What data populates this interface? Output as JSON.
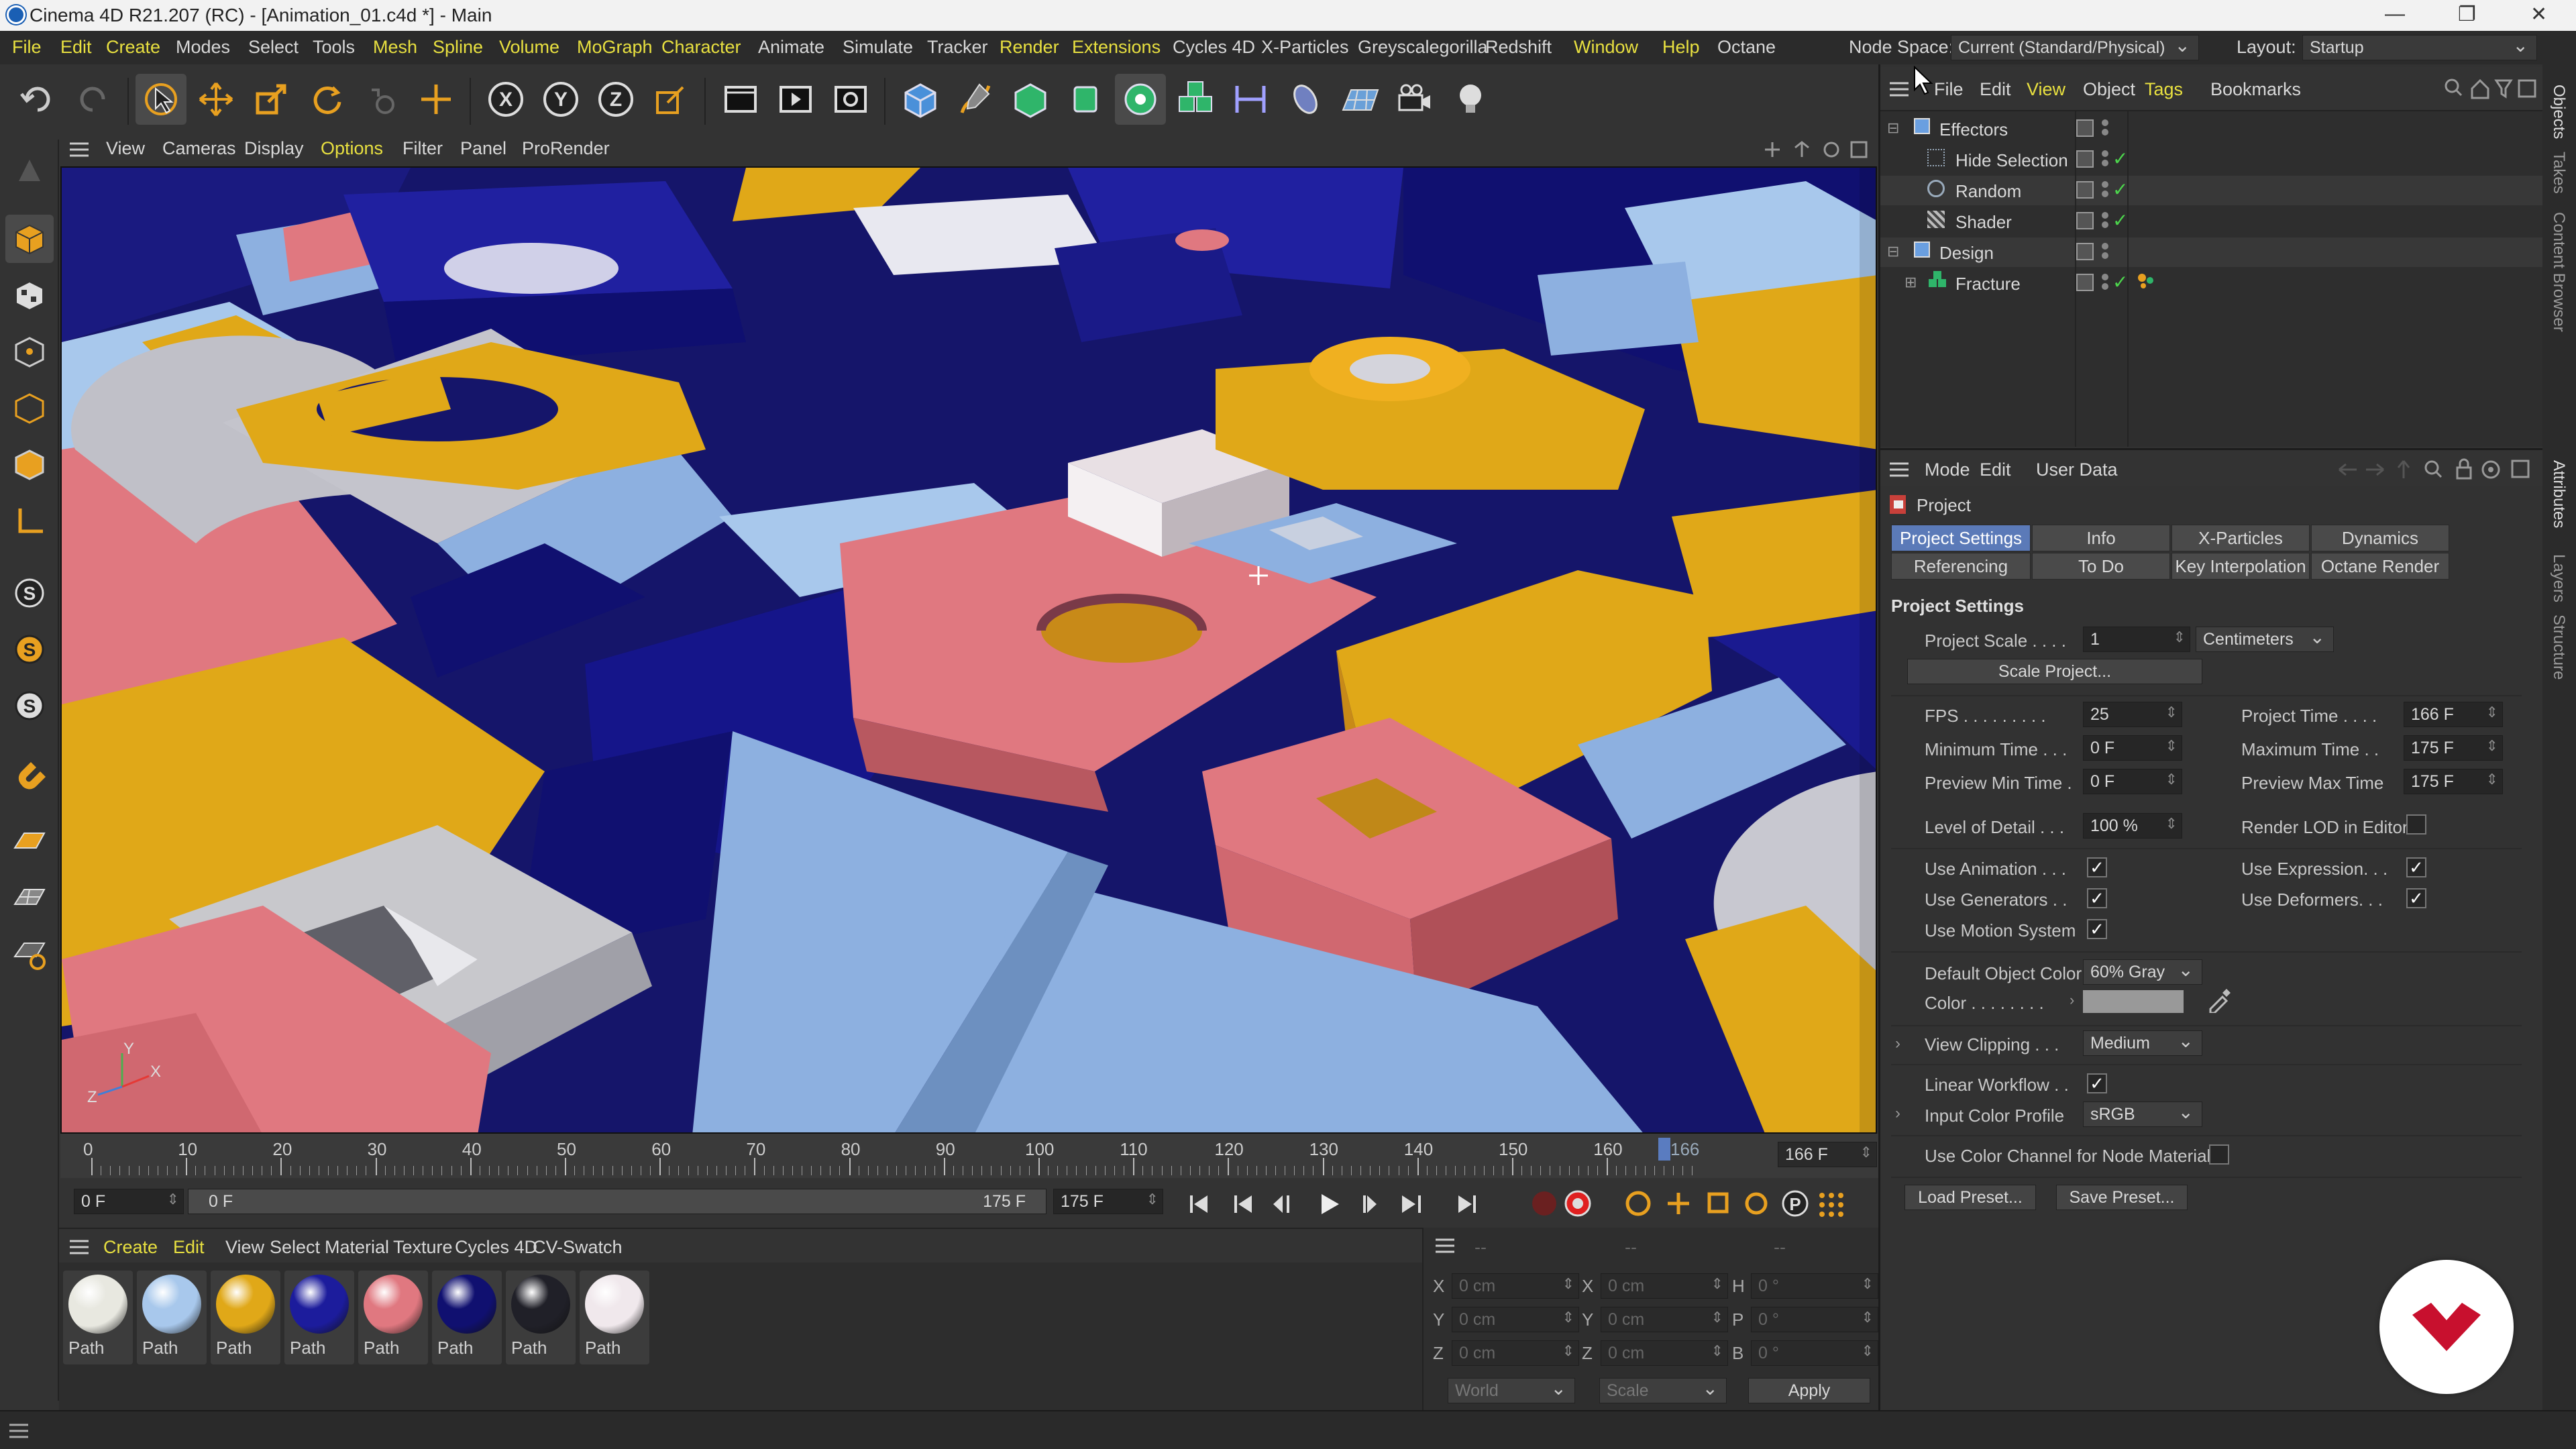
{
  "window": {
    "title": "Cinema 4D R21.207 (RC) - [Animation_01.c4d *] - Main",
    "minimize": "—",
    "restore": "❐",
    "close": "✕"
  },
  "menu": {
    "items": [
      "File",
      "Edit",
      "Create",
      "Modes",
      "Select",
      "Tools",
      "Mesh",
      "Spline",
      "Volume",
      "MoGraph",
      "Character",
      "Animate",
      "Simulate",
      "Tracker",
      "Render",
      "Extensions",
      "Cycles 4D",
      "X-Particles",
      "Greyscalegorilla",
      "Redshift",
      "Window",
      "Help",
      "Octane"
    ],
    "node_space_label": "Node Space:",
    "node_space_value": "Current (Standard/Physical)",
    "layout_label": "Layout:",
    "layout_value": "Startup"
  },
  "viewport_menu": {
    "items": [
      "View",
      "Cameras",
      "Display",
      "Options",
      "Filter",
      "Panel",
      "ProRender"
    ]
  },
  "object_manager": {
    "menu": [
      "File",
      "Edit",
      "View",
      "Object",
      "Tags",
      "Bookmarks"
    ],
    "objects": [
      {
        "name": "Effectors",
        "level": 0
      },
      {
        "name": "Hide Selection",
        "level": 1
      },
      {
        "name": "Random",
        "level": 1
      },
      {
        "name": "Shader",
        "level": 1
      },
      {
        "name": "Design",
        "level": 0
      },
      {
        "name": "Fracture",
        "level": 1
      }
    ]
  },
  "attributes": {
    "menu": [
      "Mode",
      "Edit",
      "User Data"
    ],
    "object_name": "Project",
    "tabs_row1": [
      "Project Settings",
      "Info",
      "X-Particles",
      "Dynamics"
    ],
    "tabs_row2": [
      "Referencing",
      "To Do",
      "Key Interpolation",
      "Octane Render"
    ],
    "section_title": "Project Settings",
    "project_scale_label": "Project Scale . . . .",
    "project_scale_value": "1",
    "project_scale_unit": "Centimeters",
    "scale_project_button": "Scale Project...",
    "fps_label": "FPS . . . . . . . . .",
    "fps_value": "25",
    "project_time_label": "Project Time . . . .",
    "project_time_value": "166 F",
    "min_time_label": "Minimum Time . . .",
    "min_time_value": "0 F",
    "max_time_label": "Maximum Time . .",
    "max_time_value": "175 F",
    "prev_min_label": "Preview Min Time .",
    "prev_min_value": "0 F",
    "prev_max_label": "Preview Max Time",
    "prev_max_value": "175 F",
    "lod_label": "Level of Detail . . .",
    "lod_value": "100 %",
    "render_lod_label": "Render LOD in Editor",
    "use_animation_label": "Use Animation . . .",
    "use_expression_label": "Use Expression. . .",
    "use_generators_label": "Use Generators . .",
    "use_deformers_label": "Use Deformers. . .",
    "use_motion_label": "Use Motion System",
    "default_color_label": "Default Object Color",
    "default_color_value": "60% Gray",
    "color_label": "Color . . . . . . . .",
    "view_clipping_label": "View Clipping . . .",
    "view_clipping_value": "Medium",
    "linear_workflow_label": "Linear Workflow . .",
    "input_profile_label": "Input Color Profile",
    "input_profile_value": "sRGB",
    "color_channel_label": "Use Color Channel for Node Material",
    "load_preset": "Load Preset...",
    "save_preset": "Save Preset..."
  },
  "side_tabs": [
    "Objects",
    "Takes",
    "Content Browser",
    "Attributes",
    "Layers",
    "Structure"
  ],
  "timeline": {
    "ticks": [
      "0",
      "10",
      "20",
      "30",
      "40",
      "50",
      "60",
      "70",
      "80",
      "90",
      "100",
      "110",
      "120",
      "130",
      "140",
      "150",
      "160"
    ],
    "current_marker": "166",
    "end_field": "166 F",
    "start_field": "0 F",
    "range_start": "0 F",
    "range_end": "175 F",
    "end_frame": "175 F"
  },
  "materials": {
    "menu": [
      "Create",
      "Edit",
      "View",
      "Select",
      "Material",
      "Texture",
      "Cycles 4D",
      "CV-Swatch"
    ],
    "items": [
      {
        "label": "Path",
        "color": "#e8e8e0"
      },
      {
        "label": "Path",
        "color": "#a8c8ec"
      },
      {
        "label": "Path",
        "color": "#e0a818"
      },
      {
        "label": "Path",
        "color": "#1c1c9c"
      },
      {
        "label": "Path",
        "color": "#e07880"
      },
      {
        "label": "Path",
        "color": "#101070"
      },
      {
        "label": "Path",
        "color": "#202028"
      },
      {
        "label": "Path",
        "color": "#f0e8ec"
      }
    ]
  },
  "coordinates": {
    "header_dashes": [
      "--",
      "--",
      "--"
    ],
    "rows": [
      {
        "a": "X",
        "av": "0 cm",
        "b": "X",
        "bv": "0 cm",
        "c": "H",
        "cv": "0 °"
      },
      {
        "a": "Y",
        "av": "0 cm",
        "b": "Y",
        "bv": "0 cm",
        "c": "P",
        "cv": "0 °"
      },
      {
        "a": "Z",
        "av": "0 cm",
        "b": "Z",
        "bv": "0 cm",
        "c": "B",
        "cv": "0 °"
      }
    ],
    "world": "World",
    "scale": "Scale",
    "apply": "Apply"
  },
  "axis": {
    "x": "X",
    "y": "Y",
    "z": "Z"
  },
  "colors": {
    "accent": "#e8e040",
    "active_tab": "#5b7ab8",
    "brand": "#c8102e"
  }
}
